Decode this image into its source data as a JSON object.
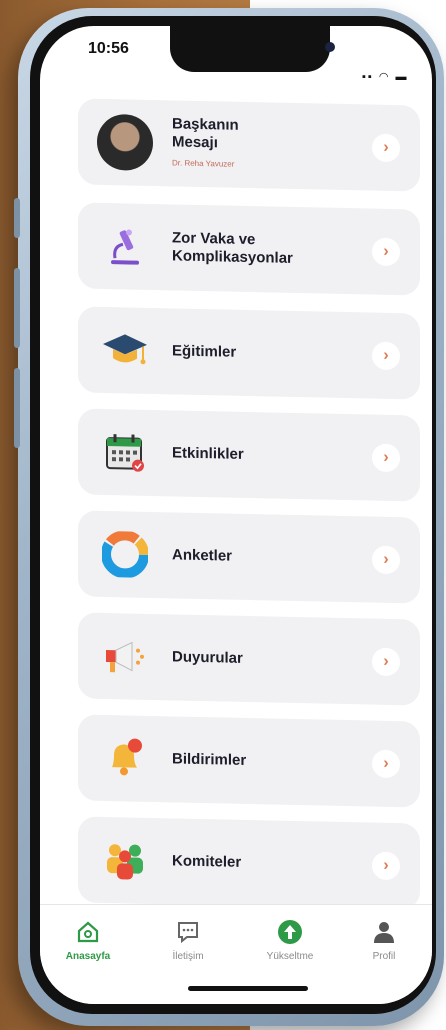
{
  "status_bar": {
    "time": "10:56",
    "indicators": "▪▪ ◠ ▬"
  },
  "menu": [
    {
      "id": "baskan",
      "label": "Başkanın Mesajı",
      "label_lines": [
        "Başkanın",
        "Mesajı"
      ],
      "sublabel": "Dr. Reha Yavuzer",
      "icon": "avatar-photo"
    },
    {
      "id": "zor-vaka",
      "label_lines": [
        "Zor Vaka ve",
        "Komplikasyonlar"
      ],
      "icon": "microscope-icon"
    },
    {
      "id": "egitimler",
      "label_lines": [
        "Eğitimler"
      ],
      "icon": "graduation-cap-icon"
    },
    {
      "id": "etkinlikler",
      "label_lines": [
        "Etkinlikler"
      ],
      "icon": "calendar-icon"
    },
    {
      "id": "anketler",
      "label_lines": [
        "Anketler"
      ],
      "icon": "pie-chart-icon"
    },
    {
      "id": "duyurular",
      "label_lines": [
        "Duyurular"
      ],
      "icon": "megaphone-icon"
    },
    {
      "id": "bildirimler",
      "label_lines": [
        "Bildirimler"
      ],
      "icon": "bell-icon"
    },
    {
      "id": "komiteler",
      "label_lines": [
        "Komiteler"
      ],
      "icon": "people-group-icon"
    }
  ],
  "chevron": "›",
  "tabs": [
    {
      "label": "Anasayfa",
      "icon": "home-icon",
      "active": true
    },
    {
      "label": "İletişim",
      "icon": "chat-icon",
      "active": false
    },
    {
      "label": "Yükseltme",
      "icon": "upgrade-arrow-icon",
      "active": false
    },
    {
      "label": "Profil",
      "icon": "person-icon",
      "active": false
    }
  ],
  "colors": {
    "accent": "#2e9a47",
    "chevron": "#e07a55",
    "card_bg": "#f1f1f3"
  }
}
